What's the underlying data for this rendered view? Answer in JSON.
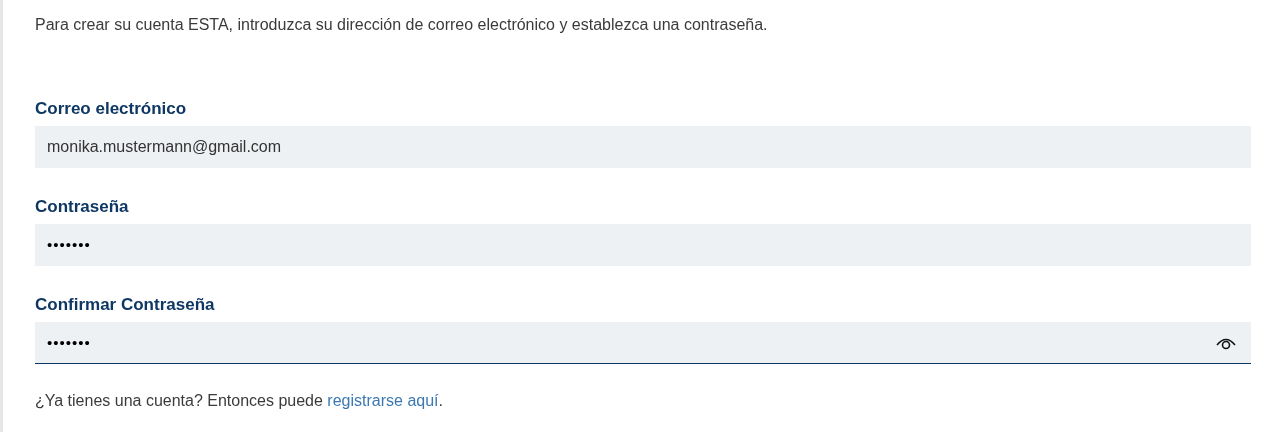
{
  "intro": "Para crear su cuenta ESTA, introduzca su dirección de correo electrónico y establezca una contraseña.",
  "fields": [
    {
      "label": "Correo electrónico",
      "value": "monika.mustermann@gmail.com",
      "kind": "text",
      "focused": false,
      "reveal_toggle": false
    },
    {
      "label": "Contraseña",
      "value": "•••••••",
      "kind": "password",
      "focused": false,
      "reveal_toggle": false
    },
    {
      "label": "Confirmar Contraseña",
      "value": "•••••••",
      "kind": "password",
      "focused": true,
      "reveal_toggle": true
    }
  ],
  "footer": {
    "text": "¿Ya tienes una cuenta? Entonces puede ",
    "link": "registrarse aquí",
    "after": "."
  }
}
